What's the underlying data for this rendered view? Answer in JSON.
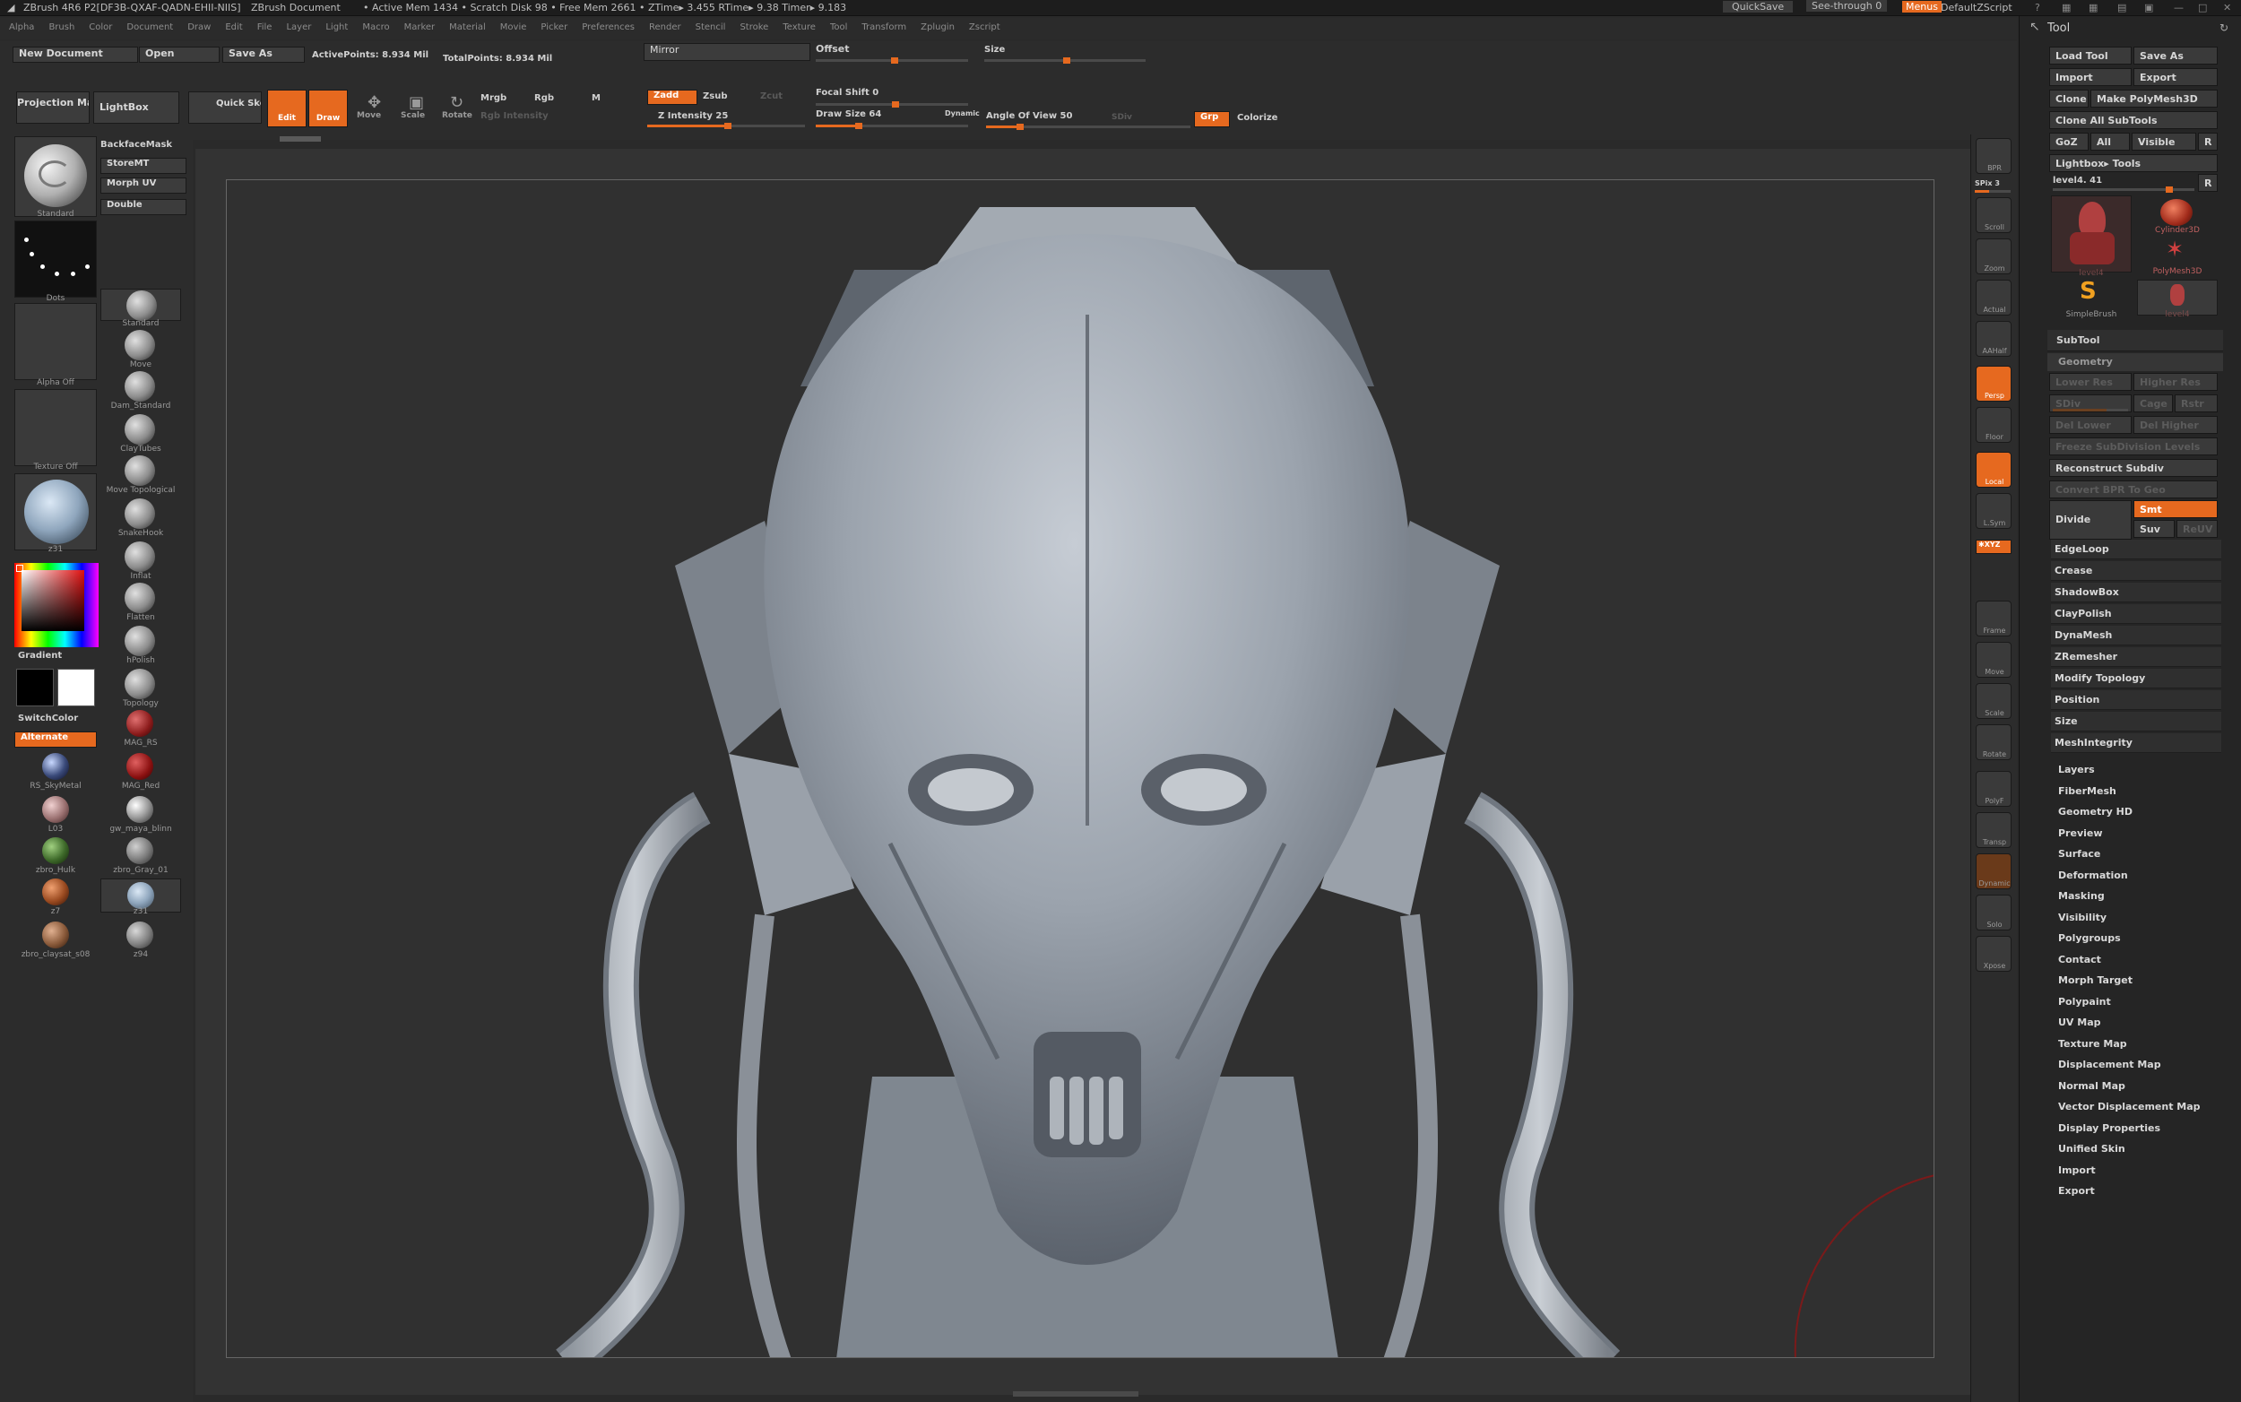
{
  "title_bar": {
    "app_title": "ZBrush 4R6 P2[DF3B-QXAF-QADN-EHII-NIIS]",
    "document": "ZBrush Document",
    "stats": "• Active Mem 1434 • Scratch Disk 98 • Free Mem 2661 • ZTime▸ 3.455 RTime▸ 9.38 Timer▸ 9.183",
    "quicksave": "QuickSave",
    "see_through": "See-through   0",
    "menus": "Menus",
    "default_zscript": "DefaultZScript"
  },
  "menu": [
    "Alpha",
    "Brush",
    "Color",
    "Document",
    "Draw",
    "Edit",
    "File",
    "Layer",
    "Light",
    "Macro",
    "Marker",
    "Material",
    "Movie",
    "Picker",
    "Preferences",
    "Render",
    "Stencil",
    "Stroke",
    "Texture",
    "Tool",
    "Transform",
    "Zplugin",
    "Zscript"
  ],
  "top": {
    "new_document": "New Document",
    "open": "Open",
    "save_as": "Save As",
    "active_points": "ActivePoints: 8.934 Mil",
    "total_points": "TotalPoints: 8.934 Mil",
    "mirror": "Mirror",
    "offset": "Offset",
    "size": "Size",
    "projection_master": "Projection Master",
    "lightbox": "LightBox",
    "quick_sketch": "Quick Sketch",
    "edit": "Edit",
    "draw": "Draw",
    "move": "Move",
    "scale": "Scale",
    "rotate": "Rotate",
    "mrgb": "Mrgb",
    "rgb": "Rgb",
    "m": "M",
    "rgb_intensity": "Rgb Intensity",
    "zadd": "Zadd",
    "zsub": "Zsub",
    "zcut": "Zcut",
    "z_intensity": "Z Intensity 25",
    "focal_shift": "Focal Shift 0",
    "draw_size": "Draw Size 64",
    "dynamic": "Dynamic",
    "angle_of_view": "Angle Of View 50",
    "stdev": "SDiv",
    "grp": "Grp",
    "colorize": "Colorize"
  },
  "left": {
    "backface_mask": "BackfaceMask",
    "store_mt": "StoreMT",
    "morph_uv": "Morph UV",
    "double": "Double",
    "standard_main": "Standard",
    "dots": "Dots",
    "alpha_off": "Alpha Off",
    "texture_off": "Texture Off",
    "mat_main": "z31",
    "gradient": "Gradient",
    "switch_color": "SwitchColor",
    "alternate": "Alternate",
    "brushes": [
      "Standard",
      "Move",
      "Dam_Standard",
      "ClayTubes",
      "Move Topological",
      "SnakeHook",
      "Inflat",
      "Flatten",
      "hPolish",
      "Topology"
    ],
    "mats_right": [
      "MAG_RS",
      "MAG_Red",
      "gw_maya_blinn",
      "zbro_Gray_01",
      "z31",
      "z94"
    ],
    "mats_left": [
      "RS_SkyMetal",
      "L03",
      "zbro_Hulk",
      "z7",
      "zbro_claysat_s08"
    ]
  },
  "right_shelf": [
    "BPR",
    "SPix 3",
    "Scroll",
    "Zoom",
    "Actual",
    "AAHalf",
    "Persp",
    "Floor",
    "Local",
    "L.Sym",
    "✱XYZ",
    "Frame",
    "Move",
    "Scale",
    "Rotate",
    "PolyF",
    "Transp",
    "Dynamic",
    "Solo",
    "Xpose"
  ],
  "tool": {
    "title": "Tool",
    "load_tool": "Load Tool",
    "save_as": "Save As",
    "import": "Import",
    "export": "Export",
    "clone": "Clone",
    "make_polymesh": "Make PolyMesh3D",
    "clone_all": "Clone All SubTools",
    "goz": "GoZ",
    "all": "All",
    "visible": "Visible",
    "r": "R",
    "lightbox_tools": "Lightbox▸ Tools",
    "level": "level4. 41",
    "thumbs": [
      "level4",
      "Cylinder3D",
      "PolyMesh3D",
      "SimpleBrush",
      "level4"
    ],
    "subtool": "SubTool",
    "geometry": "Geometry",
    "lower_res": "Lower Res",
    "higher_res": "Higher Res",
    "sdiv": "SDiv",
    "cage": "Cage",
    "rstr": "Rstr",
    "del_lower": "Del Lower",
    "del_higher": "Del Higher",
    "freeze_sub": "Freeze SubDivision Levels",
    "reconstruct": "Reconstruct Subdiv",
    "convert_bpr": "Convert BPR To Geo",
    "divide": "Divide",
    "smt": "Smt",
    "suv": "Suv",
    "reuv": "ReUV",
    "geo_items": [
      "EdgeLoop",
      "Crease",
      "ShadowBox",
      "ClayPolish",
      "DynaMesh",
      "ZRemesher",
      "Modify Topology",
      "Position",
      "Size",
      "MeshIntegrity"
    ],
    "sections": [
      "Layers",
      "FiberMesh",
      "Geometry HD",
      "Preview",
      "Surface",
      "Deformation",
      "Masking",
      "Visibility",
      "Polygroups",
      "Contact",
      "Morph Target",
      "Polypaint",
      "UV Map",
      "Texture Map",
      "Displacement Map",
      "Normal Map",
      "Vector Displacement Map",
      "Display Properties",
      "Unified Skin",
      "Import",
      "Export"
    ]
  },
  "colors": {
    "accent": "#e6691f",
    "bg": "#2a2a2a",
    "panel": "#252525"
  }
}
